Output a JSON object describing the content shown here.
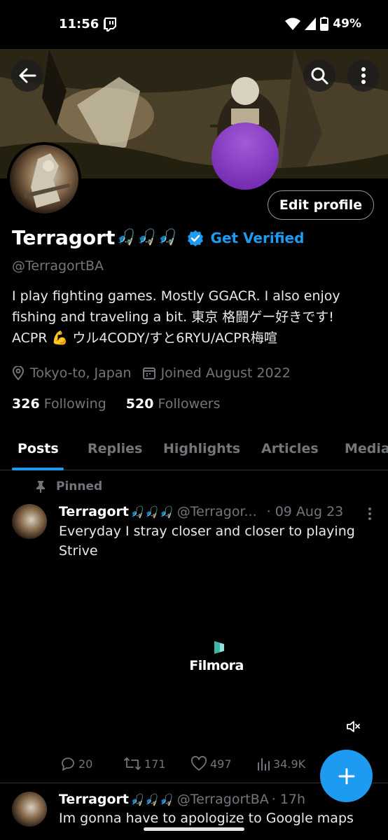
{
  "status_bar": {
    "time": "11:56",
    "battery": "49%"
  },
  "profile": {
    "display_name": "Terragort",
    "name_emoji": "🎣🎣🎣",
    "get_verified": "Get Verified",
    "handle": "@TerragortBA",
    "edit_button": "Edit profile",
    "bio_lines": [
      "I play fighting games. Mostly GGACR. I also enjoy",
      "fishing and traveling a bit. 東京 格闘ゲー好きです!",
      "ACPR 💪 ウル4CODY/すと6RYU/ACPR梅喧"
    ],
    "location": "Tokyo-to, Japan",
    "joined": "Joined August 2022",
    "following_count": "326",
    "following_label": "Following",
    "followers_count": "520",
    "followers_label": "Followers"
  },
  "tabs": [
    "Posts",
    "Replies",
    "Highlights",
    "Articles",
    "Media"
  ],
  "pinned_label": "Pinned",
  "posts": [
    {
      "name": "Terragort",
      "emoji": "🎣🎣🎣",
      "handle": "@Terragor...",
      "date": "· 09 Aug 23",
      "text": "Everyday I stray closer and closer to playing Strive",
      "media_watermark": "Filmora",
      "stats": {
        "replies": "20",
        "reposts": "171",
        "likes": "497",
        "views": "34.9K"
      }
    },
    {
      "name": "Terragort",
      "emoji": "🎣🎣🎣",
      "handle": "@TerragortBA",
      "date": "· 17h",
      "text": "Im gonna have to apologize to Google maps"
    }
  ],
  "colors": {
    "accent": "#1d9bf0",
    "muted": "#71767b",
    "background": "#000000"
  },
  "icons": [
    "back-arrow-icon",
    "search-icon",
    "more-vertical-icon",
    "verified-badge-icon",
    "location-pin-icon",
    "calendar-icon",
    "pin-icon",
    "reply-icon",
    "repost-icon",
    "like-icon",
    "views-icon",
    "mute-icon",
    "compose-plus-icon"
  ]
}
